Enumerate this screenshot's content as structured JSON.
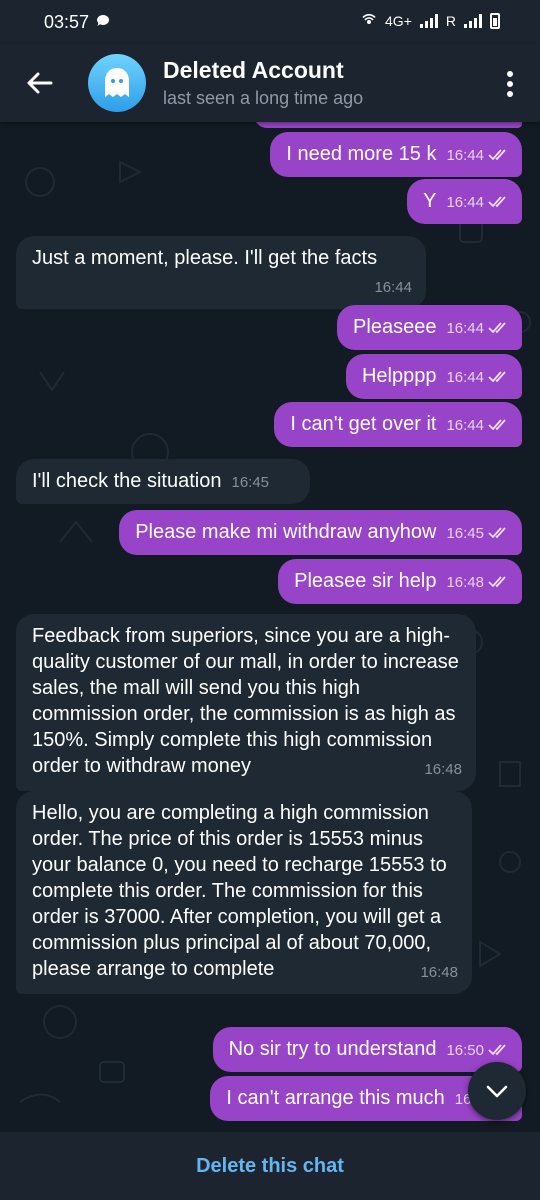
{
  "status_bar": {
    "time": "03:57",
    "network": "4G+",
    "roaming": "R"
  },
  "header": {
    "title": "Deleted Account",
    "subtitle": "last seen a long time ago"
  },
  "messages": [
    {
      "dir": "out",
      "text": "I need more 15 k",
      "time": "16:44",
      "read": true
    },
    {
      "dir": "out",
      "text": "Y",
      "time": "16:44",
      "read": true
    },
    {
      "dir": "in",
      "text": "Just a moment, please. I'll get the facts",
      "time": "16:44"
    },
    {
      "dir": "out",
      "text": "Pleaseee",
      "time": "16:44",
      "read": true
    },
    {
      "dir": "out",
      "text": "Helpppp",
      "time": "16:44",
      "read": true
    },
    {
      "dir": "out",
      "text": "I can't get over it",
      "time": "16:44",
      "read": true
    },
    {
      "dir": "in",
      "text": "I'll check the situation",
      "time": "16:45"
    },
    {
      "dir": "out",
      "text": "Please make mi withdraw anyhow",
      "time": "16:45",
      "read": true
    },
    {
      "dir": "out",
      "text": "Pleasee sir help",
      "time": "16:48",
      "read": true
    },
    {
      "dir": "in",
      "text": "Feedback from superiors, since you are a high-quality customer of our mall, in order to increase sales, the mall will send you this high commission order, the commission is as high as 150%. Simply complete this high commission order to withdraw money",
      "time": "16:48"
    },
    {
      "dir": "in",
      "text": "Hello, you are completing a high commission order. The price of this order is 15553 minus your balance 0, you need to recharge 15553 to complete this order. The commission for this order is 37000. After completion, you will get a commission plus principal al of about 70,000, please arrange to complete",
      "time": "16:48"
    },
    {
      "dir": "out",
      "text": "No sir try to understand",
      "time": "16:50",
      "read": true
    },
    {
      "dir": "out",
      "text": "I can't arrange this much",
      "time": "16:5",
      "read": false
    }
  ],
  "footer": {
    "delete_label": "Delete this chat"
  },
  "colors": {
    "outgoing": "#9744c8",
    "incoming": "#1f2933",
    "accent": "#64b5f0",
    "background": "#121a23"
  }
}
